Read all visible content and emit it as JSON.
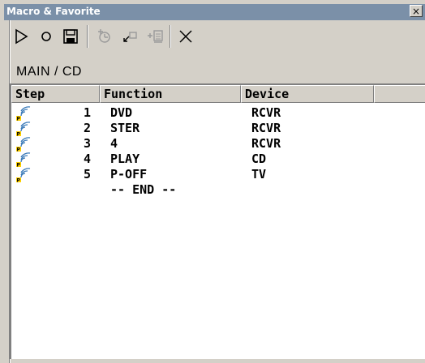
{
  "window": {
    "title": "Macro & Favorite",
    "close_label": "×"
  },
  "toolbar": {
    "buttons": [
      {
        "icon": "play-icon"
      },
      {
        "icon": "record-icon"
      },
      {
        "icon": "save-icon"
      },
      {
        "icon": "insert-step-icon"
      },
      {
        "icon": "move-step-icon"
      },
      {
        "icon": "add-end-icon"
      },
      {
        "icon": "delete-icon"
      }
    ]
  },
  "breadcrumb": "MAIN / CD",
  "table": {
    "columns": [
      "Step",
      "Function",
      "Device",
      ""
    ],
    "rows": [
      {
        "step": "1",
        "function": "DVD",
        "device": "RCVR"
      },
      {
        "step": "2",
        "function": "STER",
        "device": "RCVR"
      },
      {
        "step": "3",
        "function": "4",
        "device": "RCVR"
      },
      {
        "step": "4",
        "function": "PLAY",
        "device": "CD"
      },
      {
        "step": "5",
        "function": "P-OFF",
        "device": "TV"
      }
    ],
    "end_marker": "-- END --"
  },
  "colors": {
    "titlebar": "#7b90a8",
    "background": "#d4d0c8",
    "list_bg": "#ffffff"
  }
}
